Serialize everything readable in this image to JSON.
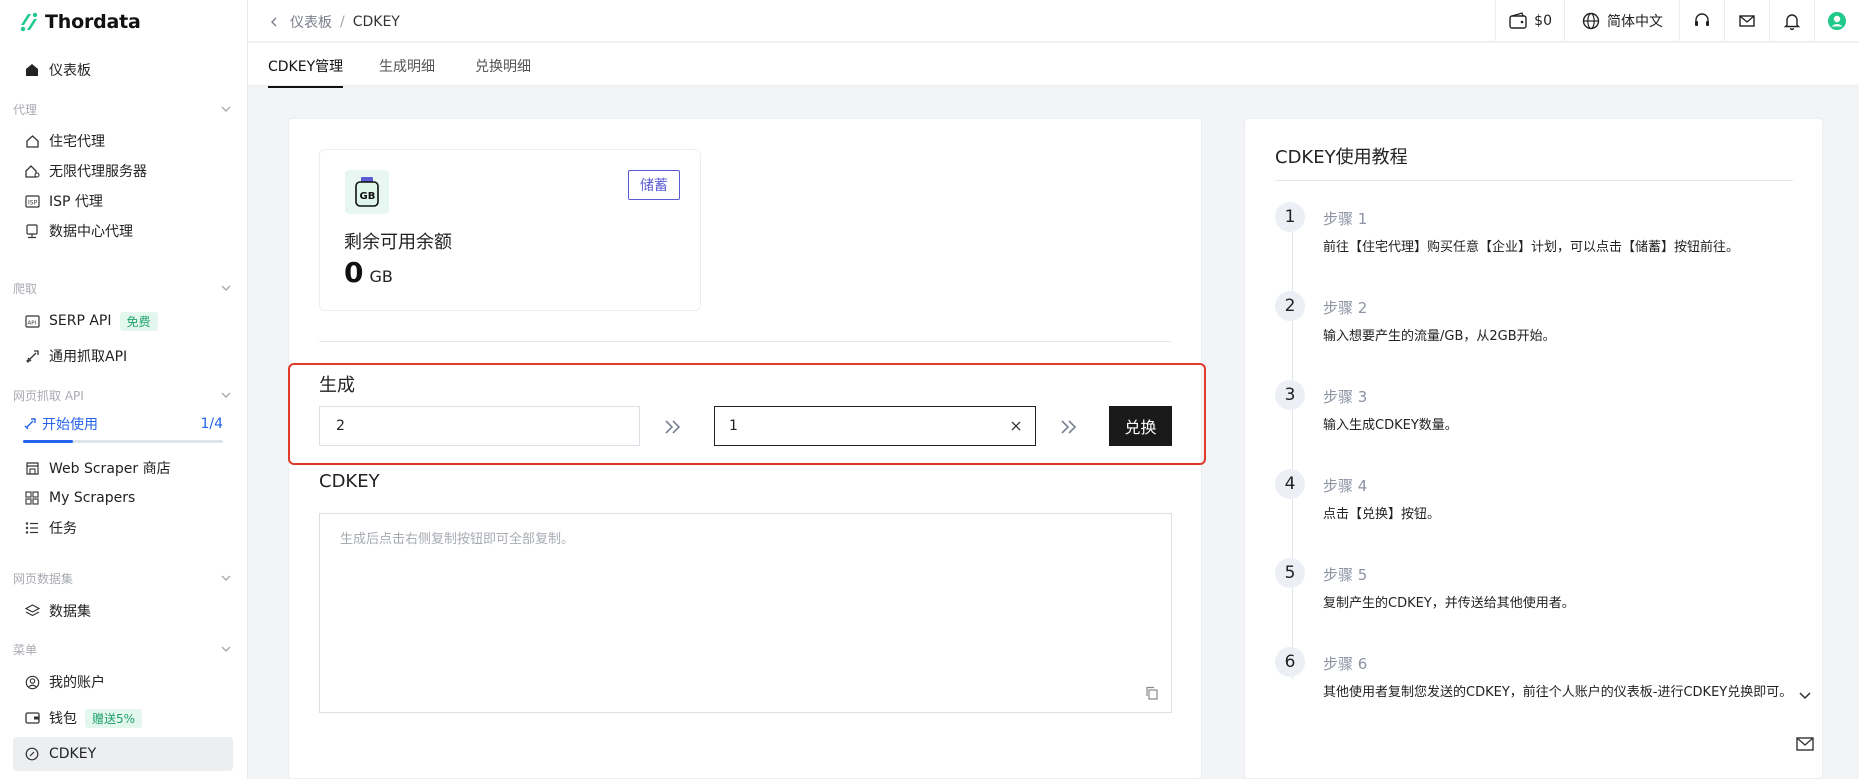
{
  "brand": {
    "name": "Thordata"
  },
  "sidebar": {
    "dashboard": "仪表板",
    "group_proxy": "代理",
    "residential": "住宅代理",
    "unlimited": "无限代理服务器",
    "isp": "ISP 代理",
    "datacenter": "数据中心代理",
    "group_scrape": "爬取",
    "serp": "SERP API",
    "serp_badge": "免费",
    "universal": "通用抓取API",
    "group_webapi": "网页抓取 API",
    "started": "开始使用",
    "started_progress": "1/4",
    "started_fraction": 0.25,
    "store": "Web Scraper 商店",
    "my_scrapers": "My Scrapers",
    "tasks": "任务",
    "group_dataset": "网页数据集",
    "dataset": "数据集",
    "group_menu": "菜单",
    "account": "我的账户",
    "wallet": "钱包",
    "wallet_badge": "赠送5%",
    "cdkey": "CDKEY"
  },
  "breadcrumb": {
    "parent": "仪表板",
    "sep": "/",
    "current": "CDKEY"
  },
  "topbar": {
    "balance": "$0",
    "language": "简体中文"
  },
  "tabs": [
    "CDKEY管理",
    "生成明细",
    "兑换明细"
  ],
  "balance_card": {
    "icon_text": "GB",
    "store_button": "储蓄",
    "label": "剩余可用余额",
    "value": "0",
    "unit": "GB"
  },
  "generate": {
    "title": "生成",
    "amount_value": "2",
    "count_value": "1",
    "redeem_button": "兑换"
  },
  "cdkey": {
    "title": "CDKEY",
    "placeholder": "生成后点击右侧复制按钮即可全部复制。"
  },
  "tutorial": {
    "title": "CDKEY使用教程",
    "steps": [
      {
        "num": "1",
        "title": "步骤 1",
        "desc": "前往【住宅代理】购买任意【企业】计划，可以点击【储蓄】按钮前往。"
      },
      {
        "num": "2",
        "title": "步骤 2",
        "desc": "输入想要产生的流量/GB，从2GB开始。"
      },
      {
        "num": "3",
        "title": "步骤 3",
        "desc": "输入生成CDKEY数量。"
      },
      {
        "num": "4",
        "title": "步骤 4",
        "desc": "点击【兑换】按钮。"
      },
      {
        "num": "5",
        "title": "步骤 5",
        "desc": "复制产生的CDKEY，并传送给其他使用者。"
      },
      {
        "num": "6",
        "title": "步骤 6",
        "desc": "其他使用者复制您发送的CDKEY，前往个人账户的仪表板-进行CDKEY兑换即可。"
      }
    ]
  }
}
